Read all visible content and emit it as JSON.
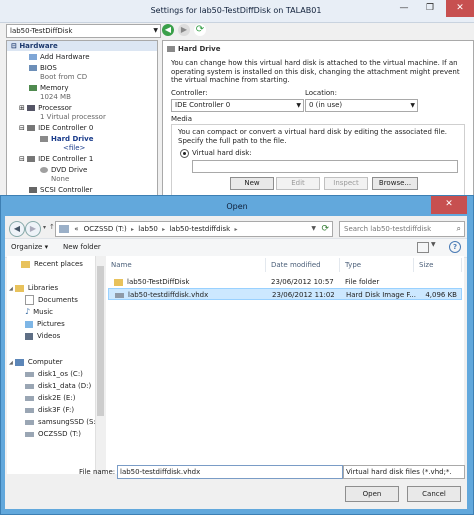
{
  "settings": {
    "title": "Settings for lab50-TestDiffDisk on TALAB01",
    "minimize": "—",
    "restore": "❐",
    "close": "✕",
    "vm_select": "lab50-TestDiffDisk",
    "tree": {
      "header": "Hardware",
      "items": [
        {
          "label": "Add Hardware",
          "sub": ""
        },
        {
          "label": "BIOS",
          "sub": "Boot from CD"
        },
        {
          "label": "Memory",
          "sub": "1024 MB"
        },
        {
          "label": "Processor",
          "sub": "1 Virtual processor"
        },
        {
          "label": "IDE Controller 0",
          "sub": ""
        },
        {
          "label": "Hard Drive",
          "sub": "<file>"
        },
        {
          "label": "IDE Controller 1",
          "sub": ""
        },
        {
          "label": "DVD Drive",
          "sub": "None"
        },
        {
          "label": "SCSI Controller",
          "sub": ""
        }
      ]
    },
    "panel": {
      "heading": "Hard Drive",
      "description": "You can change how this virtual hard disk is attached to the virtual machine. If an operating system is installed on this disk, changing the attachment might prevent the virtual machine from starting.",
      "controller_label": "Controller:",
      "controller_value": "IDE Controller 0",
      "location_label": "Location:",
      "location_value": "0 (in use)",
      "media_label": "Media",
      "media_text": "You can compact or convert a virtual hard disk by editing the associated file. Specify the full path to the file.",
      "vhd_label": "Virtual hard disk:",
      "vhd_value": "",
      "buttons": {
        "new": "New",
        "edit": "Edit",
        "inspect": "Inspect",
        "browse": "Browse..."
      }
    }
  },
  "dialog": {
    "title": "Open",
    "close": "✕",
    "address": {
      "segments": [
        "«",
        "OCZSSD (T:)",
        "lab50",
        "lab50-testdiffdisk"
      ],
      "separator": "▸"
    },
    "search_placeholder": "Search lab50-testdiffdisk",
    "toolbar": {
      "organize": "Organize ▾",
      "new_folder": "New folder"
    },
    "nav": {
      "recent": "Recent places",
      "libraries": "Libraries",
      "documents": "Documents",
      "music": "Music",
      "pictures": "Pictures",
      "videos": "Videos",
      "computer": "Computer",
      "drives": [
        "disk1_os (C:)",
        "disk1_data (D:)",
        "disk2E (E:)",
        "disk3F (F:)",
        "samsungSSD (S:)",
        "OCZSSD (T:)"
      ]
    },
    "columns": {
      "name": "Name",
      "date": "Date modified",
      "type": "Type",
      "size": "Size"
    },
    "files": [
      {
        "name": "lab50-TestDiffDisk",
        "date": "23/06/2012 10:57",
        "type": "File folder",
        "size": ""
      },
      {
        "name": "lab50-testdiffdisk.vhdx",
        "date": "23/06/2012 11:02",
        "type": "Hard Disk Image F...",
        "size": "4,096 KB"
      }
    ],
    "filename_label": "File name:",
    "filename_value": "lab50-testdiffdisk.vhdx",
    "filetype_value": "Virtual hard disk files  (*.vhd;*.",
    "open_button": "Open",
    "cancel_button": "Cancel"
  },
  "colors": {
    "accent": "#62a8dc",
    "selection": "#cce8ff",
    "close": "#c75050",
    "folder": "#e8c25c"
  }
}
